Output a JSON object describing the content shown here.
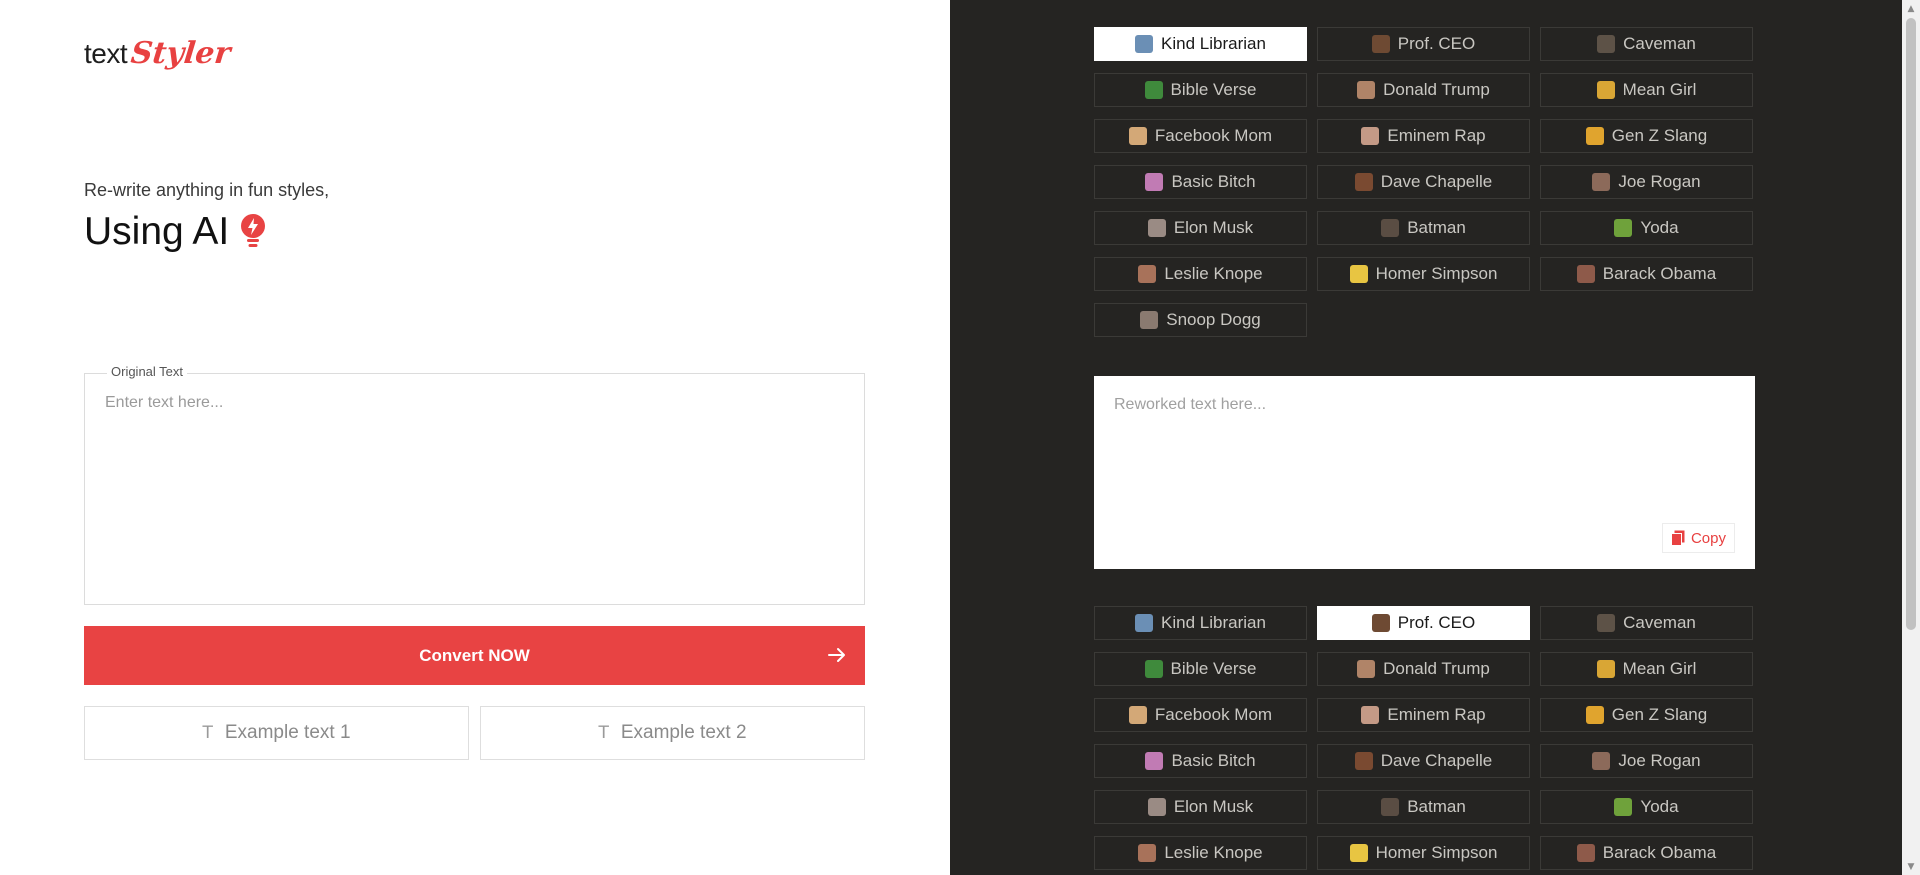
{
  "logo": {
    "text": "text",
    "accent": "Styler"
  },
  "hero": {
    "tagline": "Re-write anything in fun styles,",
    "headline": "Using AI"
  },
  "original": {
    "legend": "Original Text",
    "placeholder": "Enter text here..."
  },
  "convert_label": "Convert NOW",
  "examples": [
    {
      "icon": "text-icon",
      "label": "Example text 1"
    },
    {
      "icon": "text-icon",
      "label": "Example text 2"
    }
  ],
  "styles_top": [
    {
      "label": "Kind Librarian",
      "icon": "open-book-icon",
      "color": "#6b8fb5",
      "active": true
    },
    {
      "label": "Prof. CEO",
      "icon": "briefcase-icon",
      "color": "#6e4a33",
      "active": false
    },
    {
      "label": "Caveman",
      "icon": "caveman-icon",
      "color": "#5d5247",
      "active": false
    },
    {
      "label": "Bible Verse",
      "icon": "green-book-icon",
      "color": "#3f8a3c",
      "active": false
    },
    {
      "label": "Donald Trump",
      "icon": "trump-portrait-icon",
      "color": "#b08468",
      "active": false
    },
    {
      "label": "Mean Girl",
      "icon": "mean-girl-emoji-icon",
      "color": "#d9a635",
      "active": false
    },
    {
      "label": "Facebook Mom",
      "icon": "mom-emoji-icon",
      "color": "#d3a877",
      "active": false
    },
    {
      "label": "Eminem Rap",
      "icon": "eminem-portrait-icon",
      "color": "#c49a86",
      "active": false
    },
    {
      "label": "Gen Z Slang",
      "icon": "zany-face-icon",
      "color": "#e0a42e",
      "active": false
    },
    {
      "label": "Basic Bitch",
      "icon": "nail-polish-icon",
      "color": "#c17bb4",
      "active": false
    },
    {
      "label": "Dave Chapelle",
      "icon": "chapelle-portrait-icon",
      "color": "#7a4a31",
      "active": false
    },
    {
      "label": "Joe Rogan",
      "icon": "rogan-portrait-icon",
      "color": "#8c6a5a",
      "active": false
    },
    {
      "label": "Elon Musk",
      "icon": "musk-portrait-icon",
      "color": "#9a8b84",
      "active": false
    },
    {
      "label": "Batman",
      "icon": "batman-icon",
      "color": "#5a4d43",
      "active": false
    },
    {
      "label": "Yoda",
      "icon": "yoda-icon",
      "color": "#6fa23b",
      "active": false
    },
    {
      "label": "Leslie Knope",
      "icon": "knope-portrait-icon",
      "color": "#a8725a",
      "active": false
    },
    {
      "label": "Homer Simpson",
      "icon": "homer-icon",
      "color": "#e8c542",
      "active": false
    },
    {
      "label": "Barack Obama",
      "icon": "obama-portrait-icon",
      "color": "#8e5a4a",
      "active": false
    },
    {
      "label": "Snoop Dogg",
      "icon": "snoop-portrait-icon",
      "color": "#8a7a70",
      "active": false
    }
  ],
  "output": {
    "placeholder": "Reworked text here...",
    "copy_label": "Copy"
  },
  "styles_bottom": [
    {
      "label": "Kind Librarian",
      "icon": "open-book-icon",
      "color": "#6b8fb5",
      "active": false
    },
    {
      "label": "Prof. CEO",
      "icon": "briefcase-icon",
      "color": "#6e4a33",
      "active": true
    },
    {
      "label": "Caveman",
      "icon": "caveman-icon",
      "color": "#5d5247",
      "active": false
    },
    {
      "label": "Bible Verse",
      "icon": "green-book-icon",
      "color": "#3f8a3c",
      "active": false
    },
    {
      "label": "Donald Trump",
      "icon": "trump-portrait-icon",
      "color": "#b08468",
      "active": false
    },
    {
      "label": "Mean Girl",
      "icon": "mean-girl-emoji-icon",
      "color": "#d9a635",
      "active": false
    },
    {
      "label": "Facebook Mom",
      "icon": "mom-emoji-icon",
      "color": "#d3a877",
      "active": false
    },
    {
      "label": "Eminem Rap",
      "icon": "eminem-portrait-icon",
      "color": "#c49a86",
      "active": false
    },
    {
      "label": "Gen Z Slang",
      "icon": "zany-face-icon",
      "color": "#e0a42e",
      "active": false
    },
    {
      "label": "Basic Bitch",
      "icon": "nail-polish-icon",
      "color": "#c17bb4",
      "active": false
    },
    {
      "label": "Dave Chapelle",
      "icon": "chapelle-portrait-icon",
      "color": "#7a4a31",
      "active": false
    },
    {
      "label": "Joe Rogan",
      "icon": "rogan-portrait-icon",
      "color": "#8c6a5a",
      "active": false
    },
    {
      "label": "Elon Musk",
      "icon": "musk-portrait-icon",
      "color": "#9a8b84",
      "active": false
    },
    {
      "label": "Batman",
      "icon": "batman-icon",
      "color": "#5a4d43",
      "active": false
    },
    {
      "label": "Yoda",
      "icon": "yoda-icon",
      "color": "#6fa23b",
      "active": false
    },
    {
      "label": "Leslie Knope",
      "icon": "knope-portrait-icon",
      "color": "#a8725a",
      "active": false
    },
    {
      "label": "Homer Simpson",
      "icon": "homer-icon",
      "color": "#e8c542",
      "active": false
    },
    {
      "label": "Barack Obama",
      "icon": "obama-portrait-icon",
      "color": "#8e5a4a",
      "active": false
    }
  ],
  "colors": {
    "accent": "#e84343",
    "panel_dark": "#252422",
    "button_border": "#3b3a37"
  }
}
